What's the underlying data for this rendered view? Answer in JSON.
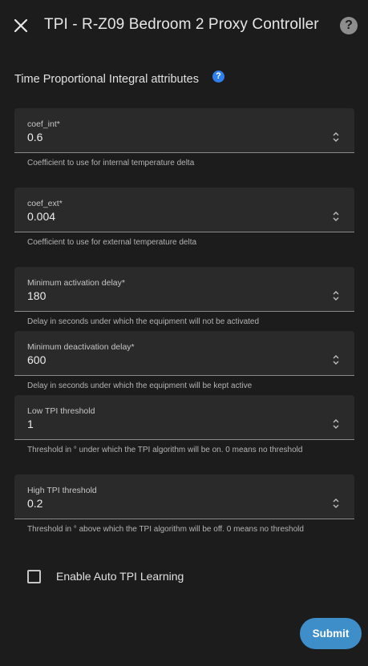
{
  "header": {
    "title": "TPI - R-Z09 Bedroom 2 Proxy Controller",
    "close_icon": "close-icon",
    "help_icon_glyph": "?"
  },
  "section": {
    "title": "Time Proportional Integral attributes",
    "info_glyph": "?"
  },
  "fields": [
    {
      "label": "coef_int*",
      "value": "0.6",
      "helper": "Coefficient to use for internal temperature delta"
    },
    {
      "label": "coef_ext*",
      "value": "0.004",
      "helper": "Coefficient to use for external temperature delta"
    },
    {
      "label": "Minimum activation delay*",
      "value": "180",
      "helper": "Delay in seconds under which the equipment will not be activated"
    },
    {
      "label": "Minimum deactivation delay*",
      "value": "600",
      "helper": "Delay in seconds under which the equipment will be kept active"
    },
    {
      "label": "Low TPI threshold",
      "value": "1",
      "helper": "Threshold in ° under which the TPI algorithm will be on. 0 means no threshold"
    },
    {
      "label": "High TPI threshold",
      "value": "0.2",
      "helper": "Threshold in ° above which the TPI algorithm will be off. 0 means no threshold"
    }
  ],
  "auto_learning": {
    "label": "Enable Auto TPI Learning",
    "checked": false
  },
  "submit": {
    "label": "Submit"
  },
  "colors": {
    "background": "#1c1c1c",
    "field_background": "#2a2a2a",
    "accent": "#3d8ec9",
    "info_icon": "#2f80ed"
  }
}
